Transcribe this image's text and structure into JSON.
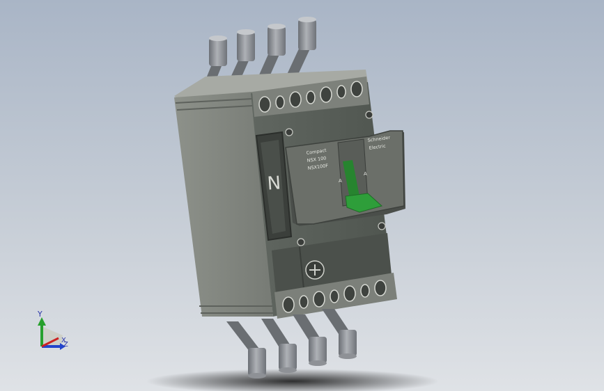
{
  "viewport": {
    "triad": {
      "x_label": "X",
      "y_label": "Y",
      "z_label": "Z"
    }
  },
  "breaker": {
    "neutral_marker": "N",
    "panel_lines": [
      "Compact",
      "NSX 100",
      "NSX100F"
    ],
    "brand_lines": [
      "Schneider",
      "Electric"
    ],
    "toggle_markings": {
      "left": "A",
      "right": "A"
    },
    "handle_color": "#2e9e3a"
  }
}
